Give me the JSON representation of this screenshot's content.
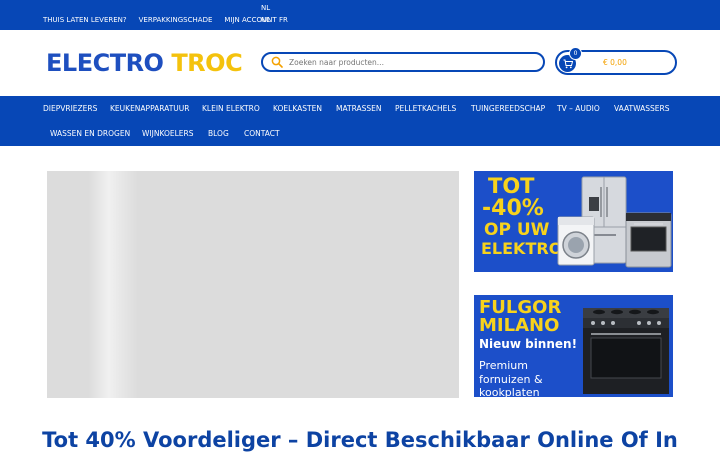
{
  "topbar": {
    "links": [
      "THUIS LATEN LEVEREN?",
      "VERPAKKINGSCHADE",
      "MIJN ACCOUNT"
    ],
    "lang_current": "NL",
    "lang_options": [
      "NL",
      "FR"
    ]
  },
  "header": {
    "logo_part1": "ELECTRO",
    "logo_part2": "TROC",
    "search_placeholder": "Zoeken naar producten...",
    "cart_count": "0",
    "cart_total": "€ 0,00"
  },
  "nav": {
    "items": [
      "DIEPVRIEZERS",
      "KEUKENAPPARATUUR",
      "KLEIN ELEKTRO",
      "KOELKASTEN",
      "MATRASSEN",
      "PELLETKACHELS",
      "TUINGEREEDSCHAP",
      "TV – AUDIO",
      "VAATWASSERS",
      "WASSEN EN DROGEN",
      "WIJNKOELERS",
      "BLOG",
      "CONTACT"
    ]
  },
  "promo1": {
    "line1": "TOT",
    "line2": "-40%",
    "line3": "OP UW",
    "line4": "ELEKTRO"
  },
  "promo2": {
    "line1": "FULGOR",
    "line2": "MILANO",
    "line3": "Nieuw binnen!",
    "line4": "Premium",
    "line5": "fornuizen &",
    "line6": "kookplaten"
  },
  "main": {
    "headline": "Tot 40% Voordeliger – Direct Beschikbaar Online Of In"
  },
  "colors": {
    "brand_blue": "#0747b6",
    "logo_yellow": "#f4c20d",
    "promo_blue": "#1c4fc9",
    "price_orange": "#f4a100"
  }
}
